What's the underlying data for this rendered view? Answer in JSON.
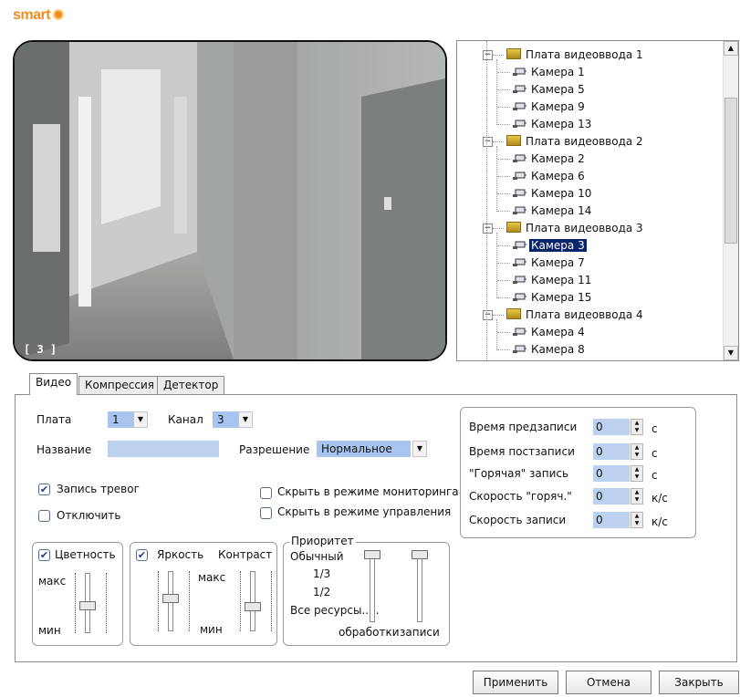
{
  "app": {
    "logo_text": "smart"
  },
  "video": {
    "channel_label": "[ 3 ]"
  },
  "tree": {
    "items": [
      {
        "label": "Плата видеоввода 1",
        "type": "board"
      },
      {
        "label": "Камера 1",
        "type": "camera"
      },
      {
        "label": "Камера 5",
        "type": "camera"
      },
      {
        "label": "Камера 9",
        "type": "camera"
      },
      {
        "label": "Камера 13",
        "type": "camera"
      },
      {
        "label": "Плата видеоввода 2",
        "type": "board"
      },
      {
        "label": "Камера 2",
        "type": "camera"
      },
      {
        "label": "Камера 6",
        "type": "camera"
      },
      {
        "label": "Камера 10",
        "type": "camera"
      },
      {
        "label": "Камера 14",
        "type": "camera"
      },
      {
        "label": "Плата видеоввода 3",
        "type": "board"
      },
      {
        "label": "Камера 3",
        "type": "camera",
        "selected": true
      },
      {
        "label": "Камера 7",
        "type": "camera"
      },
      {
        "label": "Камера 11",
        "type": "camera"
      },
      {
        "label": "Камера 15",
        "type": "camera"
      },
      {
        "label": "Плата видеоввода 4",
        "type": "board"
      },
      {
        "label": "Камера 4",
        "type": "camera"
      },
      {
        "label": "Камера 8",
        "type": "camera"
      }
    ],
    "expander_glyph": "−"
  },
  "tabs": [
    {
      "label": "Видео",
      "active": true
    },
    {
      "label": "Компрессия",
      "active": false
    },
    {
      "label": "Детектор",
      "active": false
    }
  ],
  "video_tab": {
    "board_label": "Плата",
    "board_value": "1",
    "channel_label": "Канал",
    "channel_value": "3",
    "name_label": "Название",
    "name_value": "",
    "resolution_label": "Разрешение",
    "resolution_value": "Нормальное",
    "alarm_record": {
      "label": "Запись тревог",
      "checked": true
    },
    "disable": {
      "label": "Отключить",
      "checked": false
    },
    "hide_monitoring": {
      "label": "Скрыть в режиме мониторинга",
      "checked": false
    },
    "hide_control": {
      "label": "Скрыть в режиме управления",
      "checked": false
    },
    "color_group": {
      "label": "Цветность",
      "checked": true,
      "max_label": "макс",
      "min_label": "мин",
      "level": 0.45
    },
    "brightness_group": {
      "label": "Яркость",
      "contrast_label": "Контраст",
      "checked": true,
      "max_label": "макс",
      "min_label": "мин",
      "brightness_level": 0.55,
      "contrast_level": 0.4
    },
    "priority_group": {
      "title": "Приоритет",
      "levels": [
        "Обычный",
        "1/3",
        "1/2",
        "Все ресурсы....."
      ],
      "processing_label": "обработки",
      "records_label": "записи"
    },
    "record_times": [
      {
        "label": "Время предзаписи",
        "value": "0",
        "unit": "с"
      },
      {
        "label": "Время постзаписи",
        "value": "0",
        "unit": "с"
      },
      {
        "label": "\"Горячая\" запись",
        "value": "0",
        "unit": "с"
      },
      {
        "label": "Скорость \"горяч.\"",
        "value": "0",
        "unit": "к/с"
      },
      {
        "label": "Скорость записи",
        "value": "0",
        "unit": "к/с"
      }
    ]
  },
  "glyphs": {
    "dropdown": "▼",
    "spin_up": "▲",
    "spin_down": "▼",
    "check": "✔",
    "scroll_up": "▲",
    "scroll_down": "▼"
  },
  "buttons": {
    "apply": "Применить",
    "cancel": "Отмена",
    "close": "Закрыть"
  },
  "colors": {
    "accent": "#f28c1e",
    "selection": "#0a246a",
    "field": "#bcd0f0"
  }
}
